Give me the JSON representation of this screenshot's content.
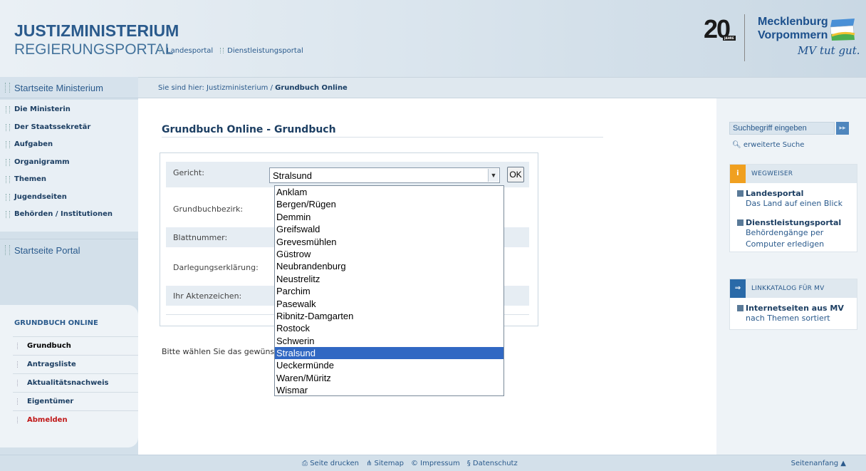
{
  "header": {
    "logo_line1": "JUSTIZMINISTERIUM",
    "logo_line2": "REGIERUNGSPORTAL",
    "nav": [
      "Landesportal",
      "Dienstleistungsportal"
    ],
    "badge_number": "20",
    "badge_sub": "JAHRE",
    "state_name_line1": "Mecklenburg",
    "state_name_line2": "Vorpommern",
    "slogan": "MV tut gut."
  },
  "breadcrumb": {
    "prefix": "Sie sind hier: Justizministerium / ",
    "current": "Grundbuch Online"
  },
  "sidebar": {
    "start_ministerium": "Startseite Ministerium",
    "items": [
      "Die Ministerin",
      "Der Staatssekretär",
      "Aufgaben",
      "Organigramm",
      "Themen",
      "Jugendseiten",
      "Behörden / Institutionen"
    ],
    "start_portal": "Startseite Portal",
    "grundbuch_title": "GRUNDBUCH ONLINE",
    "grundbuch_items": [
      "Grundbuch",
      "Antragsliste",
      "Aktualitätsnachweis",
      "Eigentümer",
      "Abmelden"
    ]
  },
  "main": {
    "title": "Grundbuch Online - Grundbuch",
    "fields": [
      "Gericht:",
      "Grundbuchbezirk:",
      "Blattnummer:",
      "Darlegungserklärung:",
      "Ihr Aktenzeichen:"
    ],
    "gericht_value": "Stralsund",
    "ok_label": "OK",
    "hint": "Bitte wählen Sie das gewüns"
  },
  "dropdown": {
    "options": [
      "Anklam",
      "Bergen/Rügen",
      "Demmin",
      "Greifswald",
      "Grevesmühlen",
      "Güstrow",
      "Neubrandenburg",
      "Neustrelitz",
      "Parchim",
      "Pasewalk",
      "Ribnitz-Damgarten",
      "Rostock",
      "Schwerin",
      "Stralsund",
      "Ueckermünde",
      "Waren/Müritz",
      "Wismar"
    ],
    "selected_index": 13
  },
  "right": {
    "search_placeholder": "Suchbegriff eingeben",
    "advanced_search": "erweiterte Suche",
    "wegweiser_title": "WEGWEISER",
    "wegweiser_links": [
      {
        "title": "Landesportal",
        "desc": "Das Land auf einen Blick"
      },
      {
        "title": "Dienstleistungsportal",
        "desc": "Behördengänge per Computer erledigen"
      }
    ],
    "linkkatalog_title": "LINKKATALOG FÜR MV",
    "linkkatalog_links": [
      {
        "title": "Internetseiten aus MV",
        "desc": "nach Themen sortiert"
      }
    ]
  },
  "footer": {
    "links": [
      "Seite drucken",
      "Sitemap",
      "Impressum",
      "Datenschutz"
    ],
    "top": "Seitenanfang"
  },
  "colors": {
    "brand_blue": "#2a5a8c",
    "selection_blue": "#3168c3",
    "logout_red": "#c01818",
    "wegweiser_icon": "#f0a020",
    "linkkatalog_icon": "#2a6aa8"
  },
  "icons": {
    "footer": [
      "print-icon",
      "sitemap-icon",
      "copyright-icon",
      "paragraph-icon"
    ],
    "search": "magnifier-icon"
  }
}
